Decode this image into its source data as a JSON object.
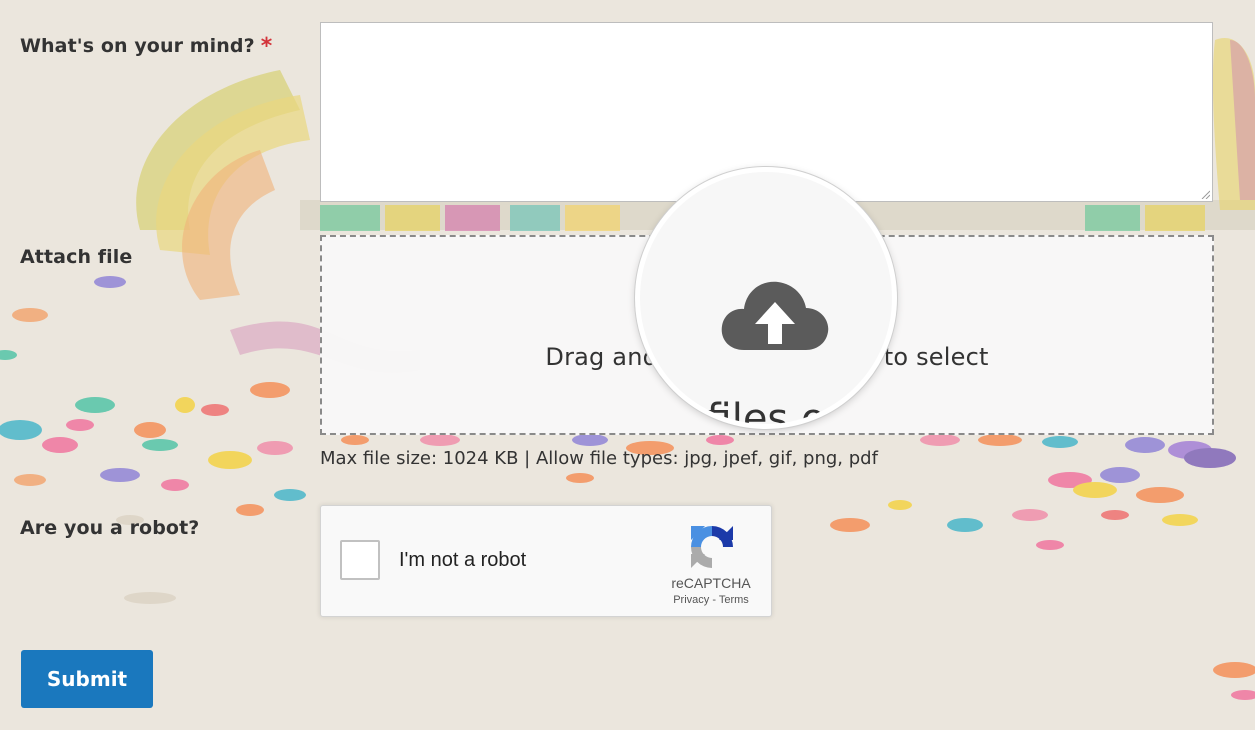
{
  "form": {
    "message_label": "What's on your mind?",
    "required_mark": "*",
    "message_value": "",
    "attach_label": "Attach file",
    "dropzone_text": "Drag and drop files here or click to select files",
    "dropzone_visible_left": "Drag and",
    "dropzone_visible_right": "to select",
    "magnified_text": "files o",
    "file_hint": "Max file size: 1024 KB | Allow file types: jpg, jpef, gif, png, pdf",
    "robot_label": "Are you a robot?",
    "submit_label": "Submit"
  },
  "recaptcha": {
    "checkbox_label": "I'm not a robot",
    "brand": "reCAPTCHA",
    "privacy_link": "Privacy",
    "separator": " - ",
    "terms_link": "Terms",
    "checked": false
  },
  "icons": {
    "upload": "cloud-upload-icon",
    "recaptcha_logo": "recaptcha-logo-icon"
  },
  "colors": {
    "accent": "#1a78be",
    "required": "#d3333a",
    "background": "#ebe6dd"
  }
}
